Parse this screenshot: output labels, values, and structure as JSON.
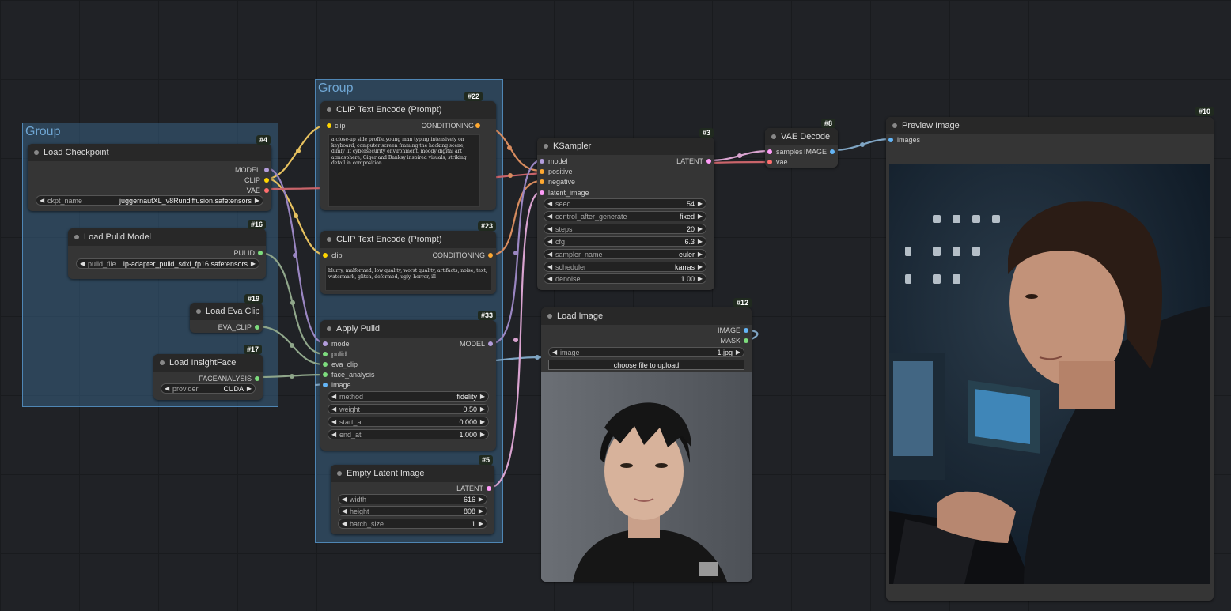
{
  "group_labels": {
    "left": "Group",
    "middle": "Group"
  },
  "nodes": {
    "load_checkpoint": {
      "title": "Load Checkpoint",
      "id": "#4",
      "outputs": [
        "MODEL",
        "CLIP",
        "VAE"
      ],
      "ckpt_label": "ckpt_name",
      "ckpt_value": "juggernautXL_v8Rundiffusion.safetensors"
    },
    "load_pulid": {
      "title": "Load Pulid Model",
      "id": "#16",
      "output": "PULID",
      "file_label": "pulid_file",
      "file_value": "ip-adapter_pulid_sdxl_fp16.safetensors"
    },
    "load_eva": {
      "title": "Load Eva Clip",
      "id": "#19",
      "output": "EVA_CLIP"
    },
    "load_insight": {
      "title": "Load InsightFace",
      "id": "#17",
      "output": "FACEANALYSIS",
      "provider_label": "provider",
      "provider_value": "CUDA"
    },
    "clip_pos": {
      "title": "CLIP Text Encode (Prompt)",
      "id": "#22",
      "input": "clip",
      "output": "CONDITIONING",
      "text": "a close-up side profile,young man typing intensively on keyboard, computer screen framing the hacking scene, dimly lit cybersecurity environment, moody digital art atmosphere, Giger and Banksy inspired visuals, striking detail in composition."
    },
    "clip_neg": {
      "title": "CLIP Text Encode (Prompt)",
      "id": "#23",
      "input": "clip",
      "output": "CONDITIONING",
      "text": "blurry, malformed, low quality, worst quality, artifacts, noise, text, watermark, glitch, deformed, ugly, horror, ill"
    },
    "apply_pulid": {
      "title": "Apply Pulid",
      "id": "#33",
      "inputs": [
        "model",
        "pulid",
        "eva_clip",
        "face_analysis",
        "image"
      ],
      "output": "MODEL",
      "widgets": [
        {
          "label": "method",
          "value": "fidelity"
        },
        {
          "label": "weight",
          "value": "0.50"
        },
        {
          "label": "start_at",
          "value": "0.000"
        },
        {
          "label": "end_at",
          "value": "1.000"
        }
      ]
    },
    "empty_latent": {
      "title": "Empty Latent Image",
      "id": "#5",
      "output": "LATENT",
      "widgets": [
        {
          "label": "width",
          "value": "616"
        },
        {
          "label": "height",
          "value": "808"
        },
        {
          "label": "batch_size",
          "value": "1"
        }
      ]
    },
    "ksampler": {
      "title": "KSampler",
      "id": "#3",
      "inputs": [
        "model",
        "positive",
        "negative",
        "latent_image"
      ],
      "output": "LATENT",
      "widgets": [
        {
          "label": "seed",
          "value": "54"
        },
        {
          "label": "control_after_generate",
          "value": "fixed"
        },
        {
          "label": "steps",
          "value": "20"
        },
        {
          "label": "cfg",
          "value": "6.3"
        },
        {
          "label": "sampler_name",
          "value": "euler"
        },
        {
          "label": "scheduler",
          "value": "karras"
        },
        {
          "label": "denoise",
          "value": "1.00"
        }
      ]
    },
    "vae_decode": {
      "title": "VAE Decode",
      "id": "#8",
      "inputs": [
        "samples",
        "vae"
      ],
      "output": "IMAGE"
    },
    "load_image": {
      "title": "Load Image",
      "id": "#12",
      "outputs": [
        "IMAGE",
        "MASK"
      ],
      "image_label": "image",
      "image_value": "1.jpg",
      "upload_label": "choose file to upload"
    },
    "preview": {
      "title": "Preview Image",
      "id": "#10",
      "input": "images"
    }
  },
  "colors": {
    "model": "#b39ddb",
    "clip": "#ffd500",
    "vae": "#ff6e6e",
    "conditioning": "#ffa931",
    "latent": "#ff9cf9",
    "image": "#64b5f6",
    "pulid": "#7ddc7d",
    "canvas": "#202226"
  }
}
